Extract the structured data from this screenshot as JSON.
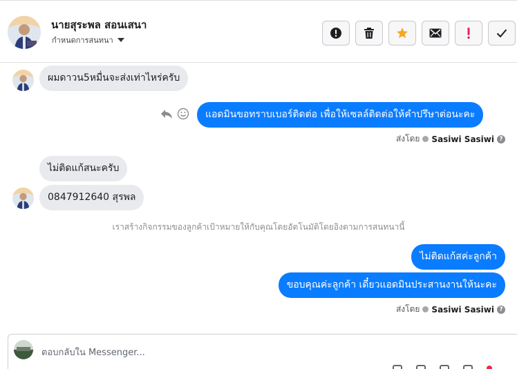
{
  "header": {
    "contact_name": "นายสุระพล สอนเสนา",
    "label_selector": "กำหนดการสนทนา",
    "actions": [
      {
        "name": "spam",
        "icon": "exclamation-circle-icon"
      },
      {
        "name": "delete",
        "icon": "trash-icon"
      },
      {
        "name": "star",
        "icon": "star-icon",
        "color": "#f5a623"
      },
      {
        "name": "mark-unread",
        "icon": "envelope-icon"
      },
      {
        "name": "follow-up",
        "icon": "exclamation-icon",
        "color": "#e0245e"
      },
      {
        "name": "done",
        "icon": "checkmark-icon"
      }
    ]
  },
  "messages": [
    {
      "direction": "in",
      "text": "ผมดาวน5หมื่นจะส่งเท่าไหร่ครับ"
    },
    {
      "direction": "out",
      "text": "แอดมินขอทราบเบอร์ติดต่อ เพื่อให้เซลล์ติดต่อให้คำปรึษาต่อนะคะ"
    },
    {
      "direction": "in",
      "text": "ไม่ติดแก้สนะครับ"
    },
    {
      "direction": "in",
      "text": "0847912640 สุรพล"
    },
    {
      "direction": "out",
      "text": "ไม่ติดแก้สค่ะลูกค้า"
    },
    {
      "direction": "out",
      "text": "ขอบคุณค่ะลูกค้า เดี๋ยวแอดมินประสานงานให้นะคะ"
    }
  ],
  "sent_by": {
    "prefix": "ส่งโดย",
    "agent": "Sasiwi Sasiwi",
    "help": "?"
  },
  "system_note": "เราสร้างกิจกรรมของลูกค้าเป้าหมายให้กับคุณโดยอัตโนมัติโดยอิงตามการสนทนานี้",
  "composer": {
    "placeholder": "ตอบกลับใน Messenger..."
  },
  "colors": {
    "accent": "#0a7cff",
    "incoming_bubble": "#e9eaed"
  }
}
